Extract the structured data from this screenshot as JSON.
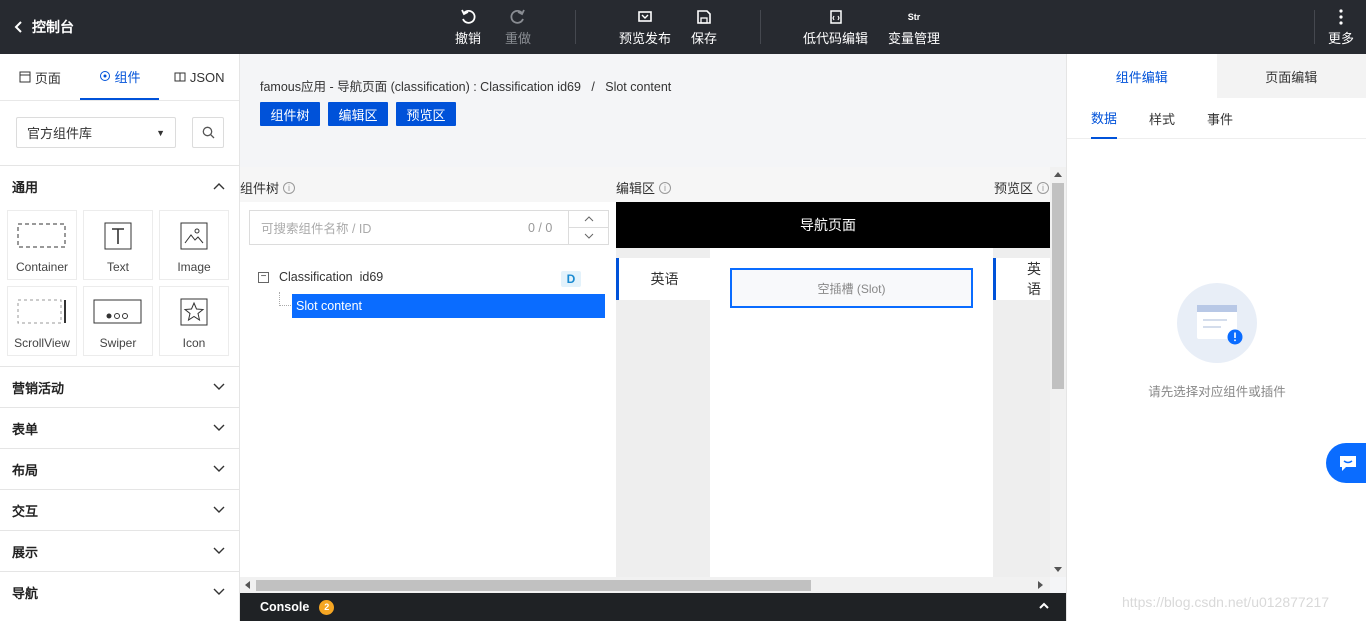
{
  "topbar": {
    "back_label": "控制台",
    "undo": "撤销",
    "redo": "重做",
    "preview_publish": "预览发布",
    "save": "保存",
    "lowcode_edit": "低代码编辑",
    "var_manage": "变量管理",
    "more": "更多",
    "str_icon_text": "Str"
  },
  "left": {
    "tabs": [
      {
        "label": "页面"
      },
      {
        "label": "组件"
      },
      {
        "label": "JSON"
      }
    ],
    "library_select": "官方组件库",
    "categories": {
      "general": "通用",
      "marketing": "营销活动",
      "form": "表单",
      "layout": "布局",
      "interaction": "交互",
      "display": "展示",
      "navigation": "导航"
    },
    "components": [
      {
        "label": "Container",
        "icon": "container-icon"
      },
      {
        "label": "Text",
        "icon": "text-icon"
      },
      {
        "label": "Image",
        "icon": "image-icon"
      },
      {
        "label": "ScrollView",
        "icon": "scrollview-icon"
      },
      {
        "label": "Swiper",
        "icon": "swiper-icon"
      },
      {
        "label": "Icon",
        "icon": "star-icon"
      }
    ]
  },
  "center": {
    "breadcrumb": "famous应用 - 导航页面 (classification) : Classification id69   /   Slot content",
    "view_buttons": [
      "组件树",
      "编辑区",
      "预览区"
    ],
    "pane_labels": {
      "tree": "组件树",
      "editor": "编辑区",
      "preview": "预览区"
    },
    "tree": {
      "search_placeholder": "可搜索组件名称 / ID",
      "count": "0 / 0",
      "node1": "Classification  id69",
      "node1_badge": "D",
      "node2": "Slot content"
    },
    "editor": {
      "nav_title": "导航页面",
      "tab_label": "英语",
      "slot_text": "空插槽 (Slot)",
      "preview_tab_label": "英语"
    },
    "console": {
      "label": "Console",
      "count": "2"
    }
  },
  "right": {
    "tabs": [
      "组件编辑",
      "页面编辑"
    ],
    "subtabs": [
      "数据",
      "样式",
      "事件"
    ],
    "empty_text": "请先选择对应组件或插件"
  },
  "watermark": "https://blog.csdn.net/u012877217",
  "colors": {
    "accent": "#0052d9",
    "selected": "#0a6cff",
    "topbar": "#272a30",
    "badge": "#f5a623"
  }
}
